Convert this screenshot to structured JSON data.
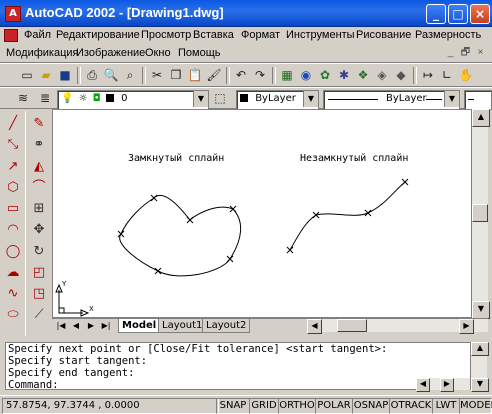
{
  "window": {
    "title": "AutoCAD 2002 - [Drawing1.dwg]",
    "app_icon_letter": "A",
    "min": "_",
    "max": "□",
    "close": "×"
  },
  "menu": {
    "row1": [
      "Файл",
      "Редактирование",
      "Просмотр",
      "Вставка",
      "Формат",
      "Инструменты",
      "Рисование",
      "Размерность"
    ],
    "row2": [
      "Модификация",
      "Изображение",
      "Окно",
      "Помощь"
    ],
    "mdi": {
      "min": "_",
      "restore": "🗗",
      "close": "×"
    }
  },
  "layers": {
    "layer_name": "0",
    "color_label": "ByLayer",
    "linetype_label": "ByLayer"
  },
  "drawing": {
    "label_closed": "Замкнутый сплайн",
    "label_open": "Незамкнутый сплайн",
    "ucs_x": "X",
    "ucs_y": "Y"
  },
  "tabs": [
    "Model",
    "Layout1",
    "Layout2"
  ],
  "command": {
    "lines": [
      "Specify next point or [Close/Fit tolerance] <start tangent>:",
      "Specify start tangent:",
      "Specify end tangent:"
    ],
    "prompt": "Command:"
  },
  "status": {
    "coords": "57.8754, 97.3744 , 0.0000",
    "toggles": [
      "SNAP",
      "GRID",
      "ORTHO",
      "POLAR",
      "OSNAP",
      "OTRACK",
      "LWT",
      "MODEL"
    ]
  }
}
